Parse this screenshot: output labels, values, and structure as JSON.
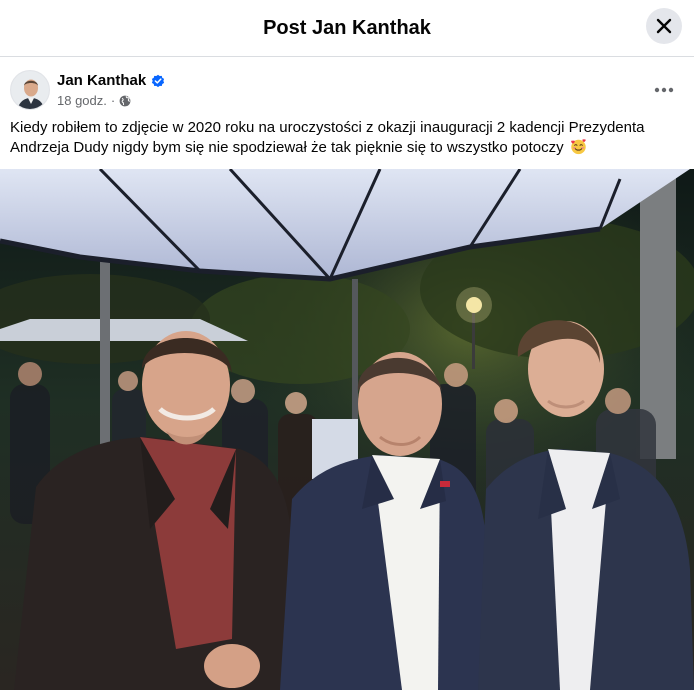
{
  "header": {
    "title": "Post Jan Kanthak",
    "close_icon": "close-icon"
  },
  "author": {
    "name": "Jan Kanthak",
    "verified_icon": "verified-badge-icon",
    "time": "18 godz.",
    "separator": "·",
    "audience_icon": "globe-icon",
    "more_icon": "more-options-icon"
  },
  "post": {
    "text": "Kiedy robiłem to zdjęcie w 2020 roku na uroczystości z okazji inauguracji 2 kadencji Prezydenta Andrzeja Dudy nigdy bym się nie spodziewał że tak pięknie się to wszystko potoczy",
    "emoji_icon": "smiling-face-with-hearts-emoji"
  },
  "colors": {
    "verified_blue": "#0866ff",
    "meta_gray": "#65676b",
    "close_bg": "#e4e6eb"
  }
}
